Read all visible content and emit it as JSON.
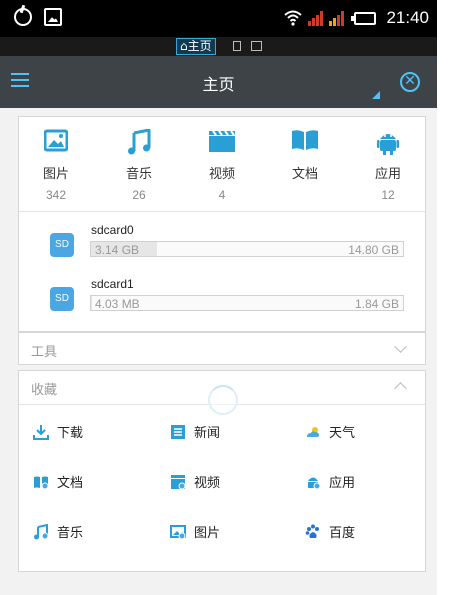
{
  "status_bar": {
    "time": "21:40"
  },
  "breadcrumb": {
    "home_label": "⌂主页"
  },
  "appbar": {
    "title": "主页"
  },
  "categories": [
    {
      "label": "图片",
      "count": "342",
      "icon": "image-icon"
    },
    {
      "label": "音乐",
      "count": "26",
      "icon": "music-icon"
    },
    {
      "label": "视频",
      "count": "4",
      "icon": "video-icon"
    },
    {
      "label": "文档",
      "count": "",
      "icon": "document-icon"
    },
    {
      "label": "应用",
      "count": "12",
      "icon": "android-icon"
    }
  ],
  "storage": [
    {
      "badge": "SD",
      "name": "sdcard0",
      "used": "3.14 GB",
      "total": "14.80 GB",
      "used_fraction": 0.21
    },
    {
      "badge": "SD",
      "name": "sdcard1",
      "used": "4.03 MB",
      "total": "1.84 GB",
      "used_fraction": 0.002
    }
  ],
  "tools": {
    "label": "工具"
  },
  "favorites": {
    "label": "收藏",
    "items": [
      {
        "label": "下载",
        "icon": "download-icon"
      },
      {
        "label": "新闻",
        "icon": "news-icon"
      },
      {
        "label": "天气",
        "icon": "weather-icon"
      },
      {
        "label": "文档",
        "icon": "document-icon"
      },
      {
        "label": "视频",
        "icon": "video-icon"
      },
      {
        "label": "应用",
        "icon": "app-icon"
      },
      {
        "label": "音乐",
        "icon": "music-icon"
      },
      {
        "label": "图片",
        "icon": "image-icon"
      },
      {
        "label": "百度",
        "icon": "baidu-icon"
      }
    ]
  },
  "colors": {
    "accent": "#4fc3f7",
    "appbar": "#3d4347",
    "status_red": "#d03a2a",
    "status_orange": "#f2a30f"
  }
}
